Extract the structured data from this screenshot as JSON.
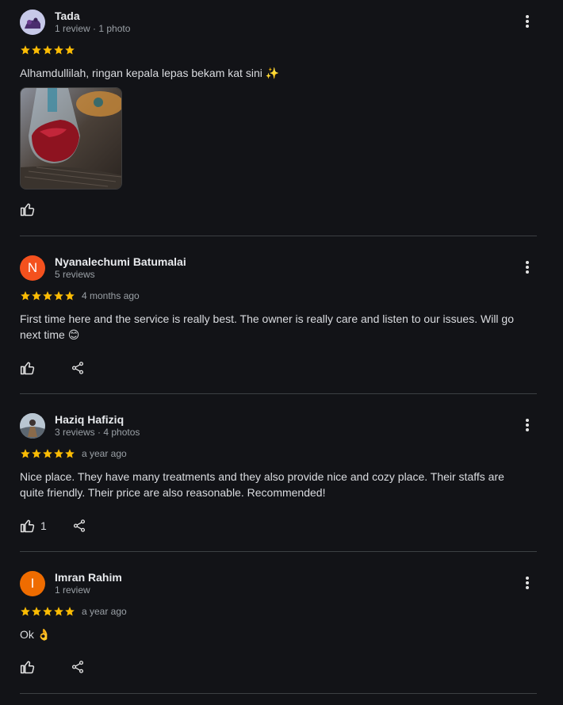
{
  "colors": {
    "background": "#121317",
    "star": "#fbbc04",
    "divider": "#3c4043",
    "avatar_n": "#f4511e",
    "avatar_i": "#ef6c00"
  },
  "reviews": [
    {
      "name": "Tada",
      "meta": "1 review · 1 photo",
      "rating": 5,
      "time": "",
      "text": "Alhamdullilah, ringan kepala lepas bekam kat sini ✨",
      "likes": "",
      "avatar_letter": "",
      "avatar_icon": "photo-avatar"
    },
    {
      "name": "Nyanalechumi Batumalai",
      "meta": "5 reviews",
      "rating": 5,
      "time": "4 months ago",
      "text": "First time here and the service is really best. The owner is really care and listen to our issues. Will go next time 😊",
      "likes": "",
      "avatar_letter": "N"
    },
    {
      "name": "Haziq Hafiziq",
      "meta": "3 reviews · 4 photos",
      "rating": 5,
      "time": "a year ago",
      "text": "Nice place. They have many treatments and they also provide nice and cozy place. Their staffs are quite friendly. Their price are also reasonable. Recommended!",
      "likes": "1",
      "avatar_letter": "",
      "avatar_icon": "photo-avatar"
    },
    {
      "name": "Imran Rahim",
      "meta": "1 review",
      "rating": 5,
      "time": "a year ago",
      "text": "Ok 👌",
      "likes": "",
      "avatar_letter": "I"
    }
  ],
  "icons": {
    "like": "thumbs-up-icon",
    "share": "share-icon",
    "more": "more-vert-icon",
    "star": "star-icon"
  }
}
